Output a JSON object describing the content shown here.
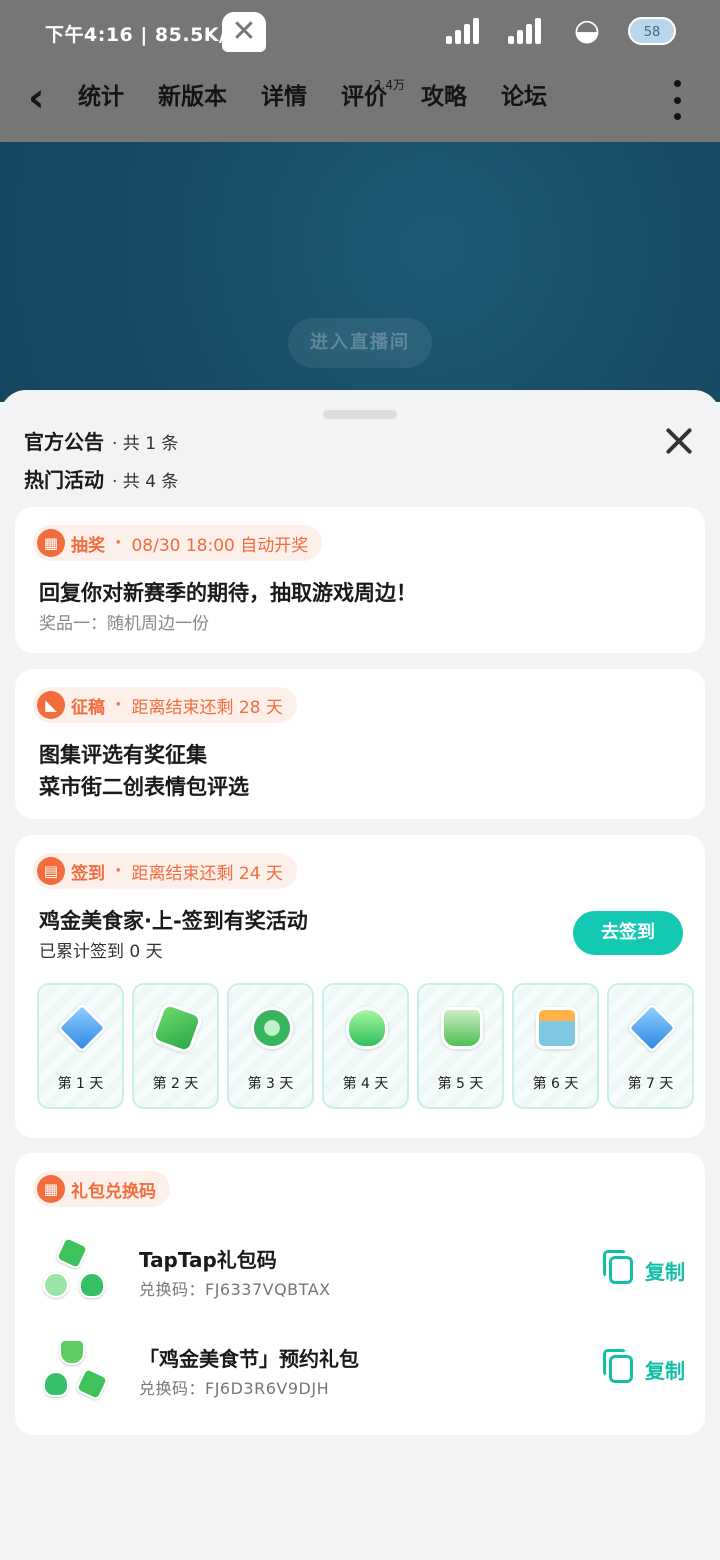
{
  "status_bar": {
    "time": "下午4:16 | 85.5K/s",
    "battery": "58",
    "icons": [
      "notification-icon",
      "signal-icon",
      "signal-icon",
      "wifi-icon",
      "battery-icon"
    ]
  },
  "nav": {
    "tabs": [
      {
        "label": "统计"
      },
      {
        "label": "新版本"
      },
      {
        "label": "详情"
      },
      {
        "label": "评价",
        "sup": "2.4万"
      },
      {
        "label": "攻略"
      },
      {
        "label": "论坛"
      }
    ],
    "active_tab": "详情"
  },
  "banner": {
    "live_button": "进入直播间"
  },
  "sheet": {
    "announce_label": "官方公告",
    "announce_count": "· 共 1 条",
    "activity_label": "热门活动",
    "activity_count": "· 共 4 条"
  },
  "lottery": {
    "tag": "抽奖",
    "dot": "·",
    "meta": "08/30 18:00 自动开奖",
    "title": "回复你对新赛季的期待，抽取游戏周边！",
    "subtitle": "奖品一：随机周边一份"
  },
  "contest": {
    "tag": "征稿",
    "dot": "·",
    "meta": "距离结束还剩 28 天",
    "title_line1": "图集评选有奖征集",
    "title_line2": "菜市街二创表情包评选"
  },
  "checkin": {
    "tag": "签到",
    "dot": "·",
    "meta": "距离结束还剩 24 天",
    "title": "鸡金美食家·上-签到有奖活动",
    "progress": "已累计签到 0 天",
    "button": "去签到",
    "days": [
      {
        "label": "第 1 天",
        "icon": "gem-icon"
      },
      {
        "label": "第 2 天",
        "icon": "cash-icon"
      },
      {
        "label": "第 3 天",
        "icon": "coin-icon"
      },
      {
        "label": "第 4 天",
        "icon": "fire-icon"
      },
      {
        "label": "第 5 天",
        "icon": "cup-icon"
      },
      {
        "label": "第 6 天",
        "icon": "jar-icon"
      },
      {
        "label": "第 7 天",
        "icon": "gem-icon"
      }
    ]
  },
  "gift": {
    "tag": "礼包兑换码",
    "copy_label": "复制",
    "items": [
      {
        "name": "TapTap礼包码",
        "code": "兑换码：FJ6337VQBTAX"
      },
      {
        "name": "「鸡金美食节」预约礼包",
        "code": "兑换码：FJ6D3R6V9DJH"
      }
    ]
  },
  "colors": {
    "accent": "#13c9b4",
    "tag_orange": "#f26d3d",
    "tag_bg": "#fdf0ea",
    "banner": "#174b63"
  }
}
